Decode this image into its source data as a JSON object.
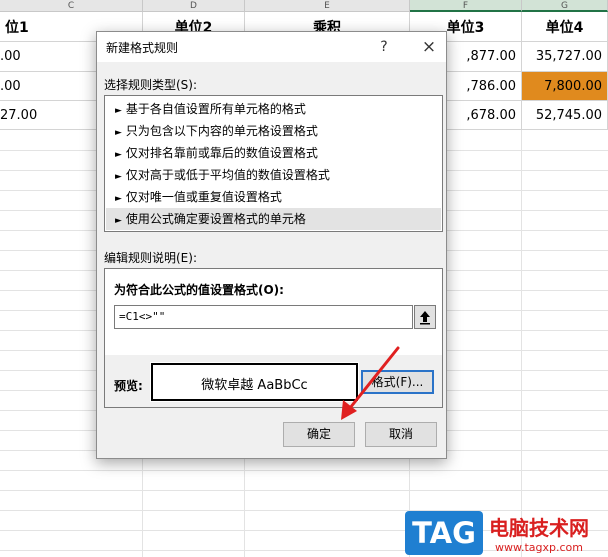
{
  "sheet": {
    "columns": [
      "C",
      "D",
      "E",
      "F",
      "G"
    ],
    "headers": [
      "位1",
      "单位2",
      "乘积",
      "单位3",
      "单位4"
    ],
    "rows": [
      [
        ".00",
        "",
        "",
        ",877.00",
        "35,727.00"
      ],
      [
        ".00",
        "",
        "",
        ",786.00",
        "7,800.00"
      ],
      [
        "27.00",
        "",
        "",
        ",678.00",
        "52,745.00"
      ]
    ],
    "highlight_color": "#E08A1E"
  },
  "dialog": {
    "title": "新建格式规则",
    "help": "?",
    "close": "×",
    "rule_type_label": "选择规则类型(S):",
    "rule_types": [
      "基于各自值设置所有单元格的格式",
      "只为包含以下内容的单元格设置格式",
      "仅对排名靠前或靠后的数值设置格式",
      "仅对高于或低于平均值的数值设置格式",
      "仅对唯一值或重复值设置格式",
      "使用公式确定要设置格式的单元格"
    ],
    "rule_arrow": "►",
    "selected_rule_index": 5,
    "edit_desc_label": "编辑规则说明(E):",
    "formula_label": "为符合此公式的值设置格式(O):",
    "formula_value": "=C1<>\"\"",
    "preview_label": "预览:",
    "preview_text": "微软卓越  AaBbCc",
    "format_button": "格式(F)...",
    "ok_button": "确定",
    "cancel_button": "取消"
  },
  "watermark": {
    "badge": "TAG",
    "site_name": "电脑技术网",
    "url": "www.tagxp.com"
  },
  "annotation_color": "#E02020"
}
